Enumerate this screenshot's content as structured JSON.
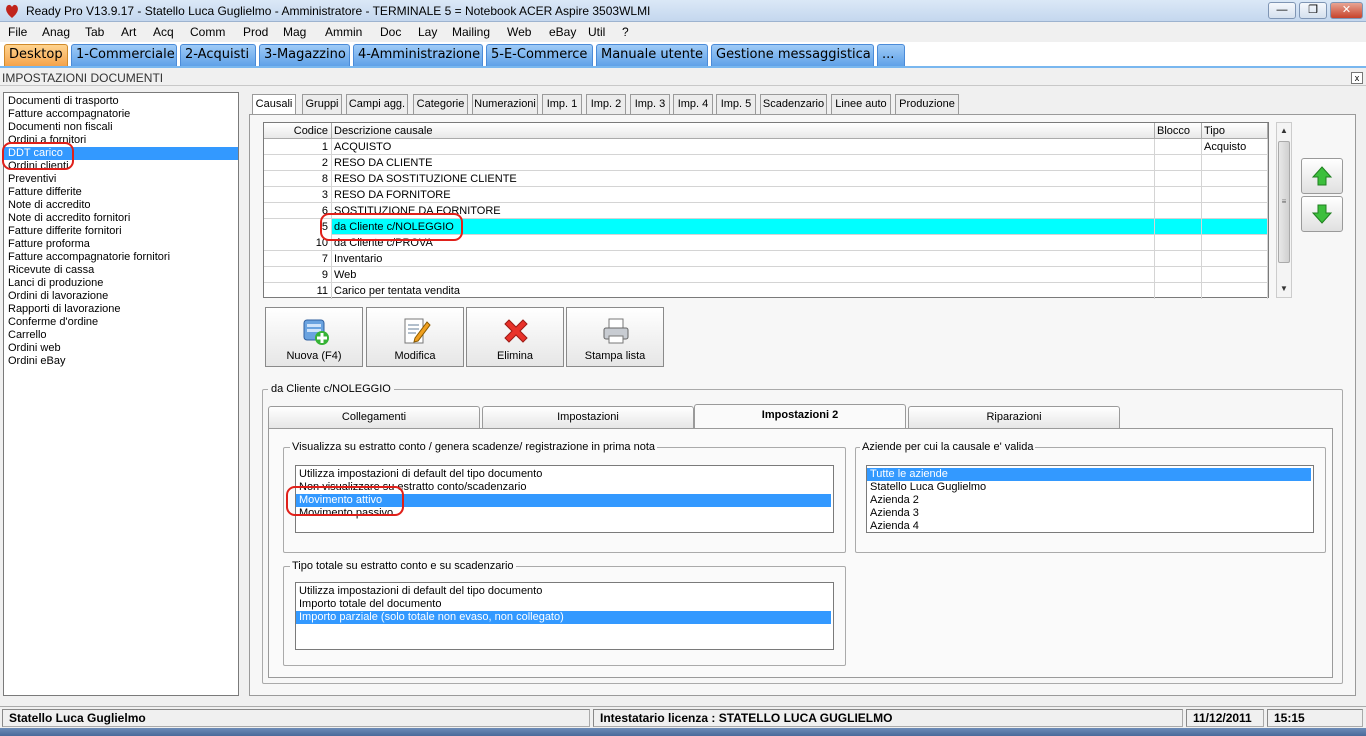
{
  "window": {
    "title": "Ready Pro V13.9.17 - Statello Luca Guglielmo - Amministratore - TERMINALE 5 = Notebook ACER Aspire 3503WLMI",
    "minimize": "0",
    "restore": "2",
    "close": "r"
  },
  "menu": [
    "File",
    "Anag",
    "Tab",
    "Art",
    "Acq",
    "Comm",
    "Prod",
    "Mag",
    "Ammin",
    "Doc",
    "Lay",
    "Mailing",
    "Web",
    "eBay",
    "Util",
    "?"
  ],
  "top_tabs": [
    "Desktop",
    "1-Commerciale",
    "2-Acquisti",
    "3-Magazzino",
    "4-Amministrazione",
    "5-E-Commerce",
    "Manuale utente",
    "Gestione messaggistica",
    "..."
  ],
  "section_title": "IMPOSTAZIONI DOCUMENTI",
  "section_close": "x",
  "doc_list": [
    "Documenti di trasporto",
    "Fatture accompagnatorie",
    "Documenti non fiscali",
    "Ordini a fornitori",
    "DDT carico",
    "Ordini clienti",
    "Preventivi",
    "Fatture differite",
    "Note di accredito",
    "Note di accredito fornitori",
    "Fatture differite fornitori",
    "Fatture proforma",
    "Fatture accompagnatorie fornitori",
    "Ricevute di cassa",
    "Lanci di produzione",
    "Ordini di lavorazione",
    "Rapporti di lavorazione",
    "Conferme d'ordine",
    "Carrello",
    "Ordini web",
    "Ordini eBay"
  ],
  "doc_list_selected": "DDT carico",
  "sub_tabs": [
    "Causali",
    "Gruppi",
    "Campi agg.",
    "Categorie",
    "Numerazioni",
    "Imp. 1",
    "Imp. 2",
    "Imp. 3",
    "Imp. 4",
    "Imp. 5",
    "Scadenzario",
    "Linee auto",
    "Produzione"
  ],
  "grid": {
    "headers": {
      "code": "Codice",
      "desc": "Descrizione causale",
      "block": "Blocco",
      "type": "Tipo"
    },
    "rows": [
      {
        "code": "1",
        "desc": "ACQUISTO",
        "type": "Acquisto"
      },
      {
        "code": "2",
        "desc": "RESO DA CLIENTE",
        "type": ""
      },
      {
        "code": "8",
        "desc": "RESO DA SOSTITUZIONE CLIENTE",
        "type": ""
      },
      {
        "code": "3",
        "desc": "RESO DA FORNITORE",
        "type": ""
      },
      {
        "code": "6",
        "desc": "SOSTITUZIONE DA FORNITORE",
        "type": ""
      },
      {
        "code": "5",
        "desc": "da Cliente c/NOLEGGIO",
        "type": ""
      },
      {
        "code": "10",
        "desc": "da Cliente c/PROVA",
        "type": ""
      },
      {
        "code": "7",
        "desc": "Inventario",
        "type": ""
      },
      {
        "code": "9",
        "desc": "Web",
        "type": ""
      },
      {
        "code": "11",
        "desc": "Carico per tentata vendita",
        "type": ""
      }
    ],
    "selected_code": "5"
  },
  "actions": {
    "new": "Nuova (F4)",
    "edit": "Modifica",
    "delete": "Elimina",
    "print": "Stampa lista"
  },
  "detail": {
    "group_title": "da Cliente c/NOLEGGIO",
    "tabs": [
      "Collegamenti",
      "Impostazioni",
      "Impostazioni 2",
      "Riparazioni"
    ],
    "active_tab": "Impostazioni 2",
    "estratto": {
      "label": "Visualizza su estratto conto / genera scadenze/ registrazione  in prima nota",
      "options": [
        "Utilizza impostazioni di default del tipo documento",
        "Non visualizzare su estratto conto/scadenzario",
        "Movimento attivo",
        "Movimento passivo"
      ],
      "selected": "Movimento attivo"
    },
    "aziende": {
      "label": "Aziende per cui la causale e' valida",
      "options": [
        "Tutte le aziende",
        "Statello Luca Guglielmo",
        "Azienda 2",
        "Azienda 3",
        "Azienda 4"
      ],
      "selected": "Tutte le aziende"
    },
    "tipo_totale": {
      "label": "Tipo totale su estratto conto e su scadenzario",
      "options": [
        "Utilizza impostazioni di default del tipo documento",
        "Importo totale del documento",
        "Importo parziale (solo totale non evaso, non collegato)"
      ],
      "selected": "Importo parziale (solo totale non evaso, non collegato)"
    }
  },
  "status": {
    "user": "Statello Luca Guglielmo",
    "license": "Intestatario licenza : STATELLO LUCA GUGLIELMO",
    "date": "11/12/2011",
    "time": "15:15"
  },
  "colors": {
    "selection": "#3399ff",
    "row_highlight": "#00ffff",
    "annotation": "#e0201a",
    "tab_active": "#f4a34b",
    "tab": "#5fa1e8"
  }
}
